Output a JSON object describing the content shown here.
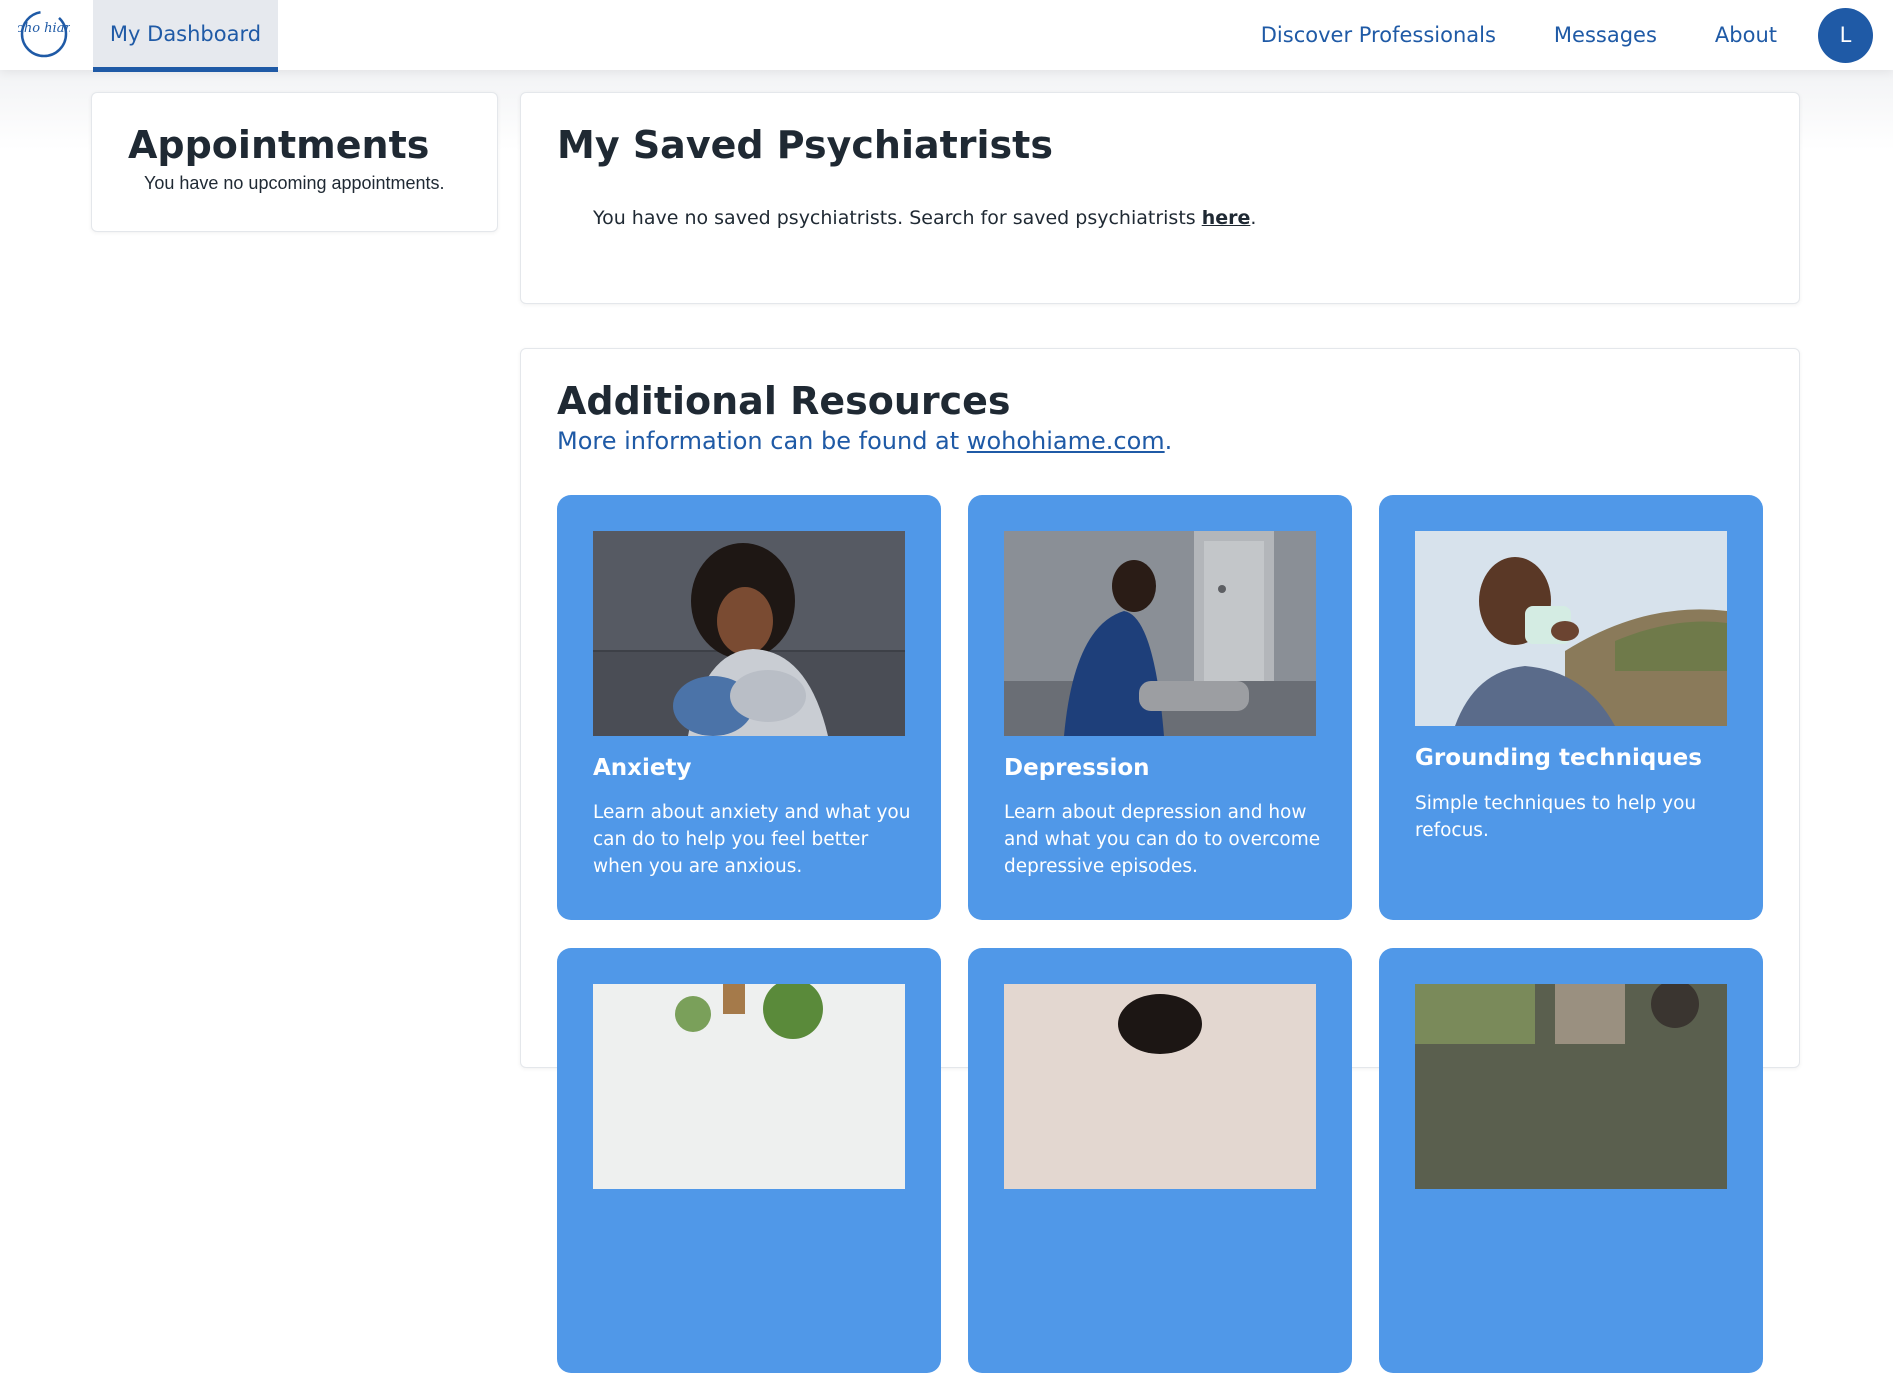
{
  "nav": {
    "logo_text": "Woho hiame",
    "dashboard_label": "My Dashboard",
    "links": [
      "Discover Professionals",
      "Messages",
      "About"
    ],
    "avatar_initial": "L"
  },
  "appointments": {
    "title": "Appointments",
    "empty_text": "You have no upcoming appointments."
  },
  "saved": {
    "title": "My Saved Psychiatrists",
    "empty_text": "You have no saved psychiatrists. Search for saved psychiatrists ",
    "link_text": "here",
    "suffix": "."
  },
  "resources": {
    "title": "Additional Resources",
    "subtitle_prefix": "More information can be found at ",
    "subtitle_link": "wohohiame.com",
    "subtitle_suffix": ".",
    "tiles": [
      {
        "title": "Anxiety",
        "description": "Learn about anxiety and what you can do to help you feel better when you are anxious.",
        "image": "woman-sitting-hugging-knees"
      },
      {
        "title": "Depression",
        "description": "Learn about depression and how and what you can do to overcome depressive episodes.",
        "image": "man-sitting-on-bed-head-in-hand"
      },
      {
        "title": "Grounding techniques",
        "description": "Simple techniques to help you refocus.",
        "image": "man-drinking-from-mug-outdoors"
      }
    ]
  },
  "colors": {
    "brand_blue": "#1f5aa6",
    "tile_blue": "#5098e8",
    "nav_active_bg": "#e6e9ee"
  }
}
